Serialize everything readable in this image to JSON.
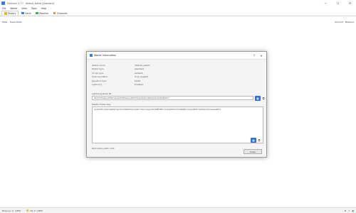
{
  "app": {
    "title": "Electrum 4.?.? - default_wallet [standard]"
  },
  "window_controls": {
    "minimize": "—",
    "maximize": "☐",
    "close": "✕"
  },
  "menu": [
    "File",
    "Wallet",
    "View",
    "Tools",
    "Help"
  ],
  "tabs": [
    {
      "label": "History",
      "color": "#f0b429"
    },
    {
      "label": "Send",
      "color": "#3b7dd8"
    },
    {
      "label": "Receive",
      "color": "#3bb34a"
    },
    {
      "label": "Channels",
      "color": "#f08a24"
    }
  ],
  "columns": {
    "left": [
      "Date",
      "Description"
    ],
    "right": [
      "Amount",
      "Balance"
    ]
  },
  "status": {
    "balance": "Balance: 0. mBTC",
    "lightning": "LN: 0. mBTC",
    "right_icons": [
      "⚙",
      "⚡",
      "●"
    ]
  },
  "dialog": {
    "title": "Wallet Information",
    "help": "?",
    "close": "✕",
    "properties": [
      {
        "label": "Wallet name",
        "value": "default_wallet"
      },
      {
        "label": "Wallet type",
        "value": "standard"
      },
      {
        "label": "Script type",
        "value": "p2wpkh"
      },
      {
        "label": "Seed available",
        "value": "True (segwit)"
      },
      {
        "label": "Keystore type",
        "value": "bip32"
      },
      {
        "label": "Lightning",
        "value": "Enabled"
      }
    ],
    "lightning_node_label": "Lightning Node ID:",
    "lightning_node_id": "02a3c5f7e9b1d3f5a7c9e1b3d5f7a9c1e3b5d7f9a1c3e5b7d9f1a3c5e7b9d1f3a5c7",
    "master_key_label": "Master Public Key",
    "master_key": "zpub6rFR7y4Q2AijBEqTUquhVz398htDFrtymD9xYYfG1m4wAcvPhXNfE3EfH1r1ADqtfSdVCToUG868RvUUkgDKf31mGDtKsAYz2oz2AGutZYs",
    "derivation_label": "Derivation path: m/0'",
    "close_button": "Close"
  }
}
